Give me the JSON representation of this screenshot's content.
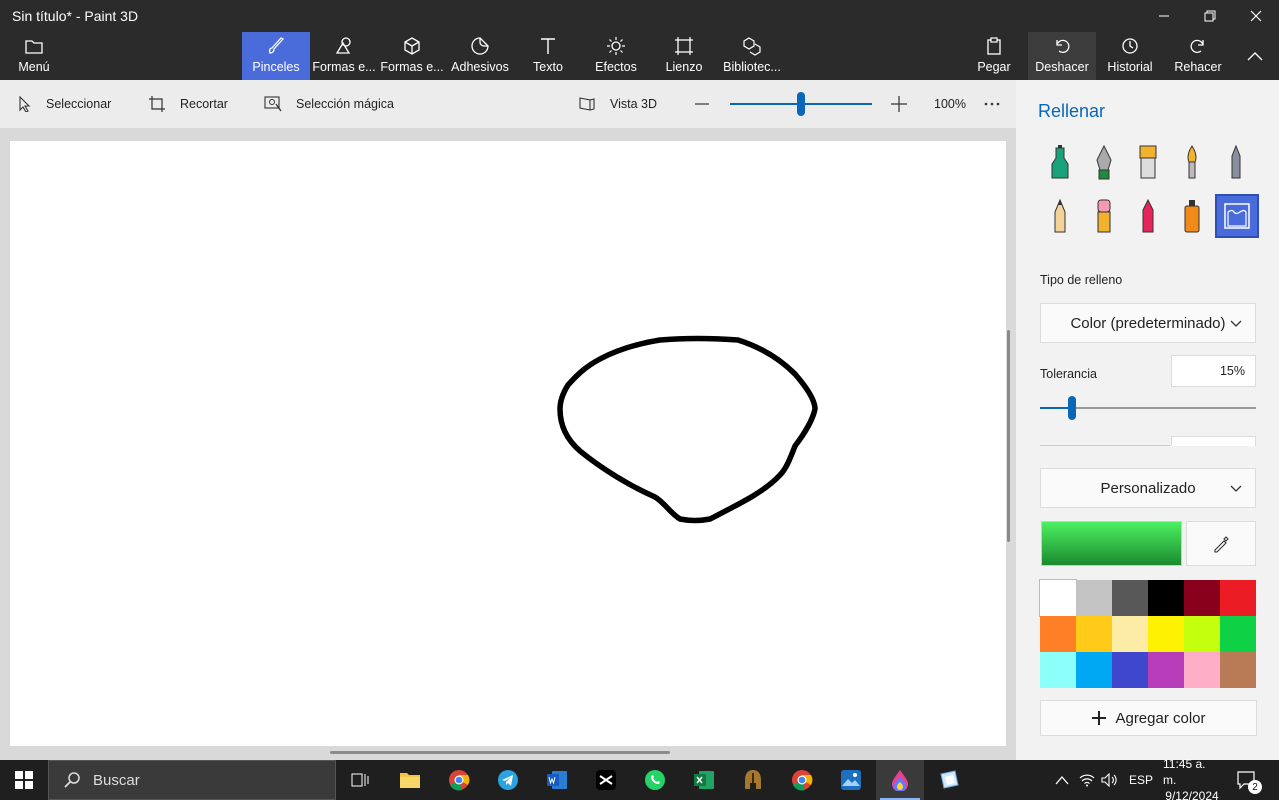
{
  "window": {
    "title": "Sin título* - Paint 3D"
  },
  "toolbar": {
    "menu": "Menú",
    "items": [
      {
        "label": "Pinceles"
      },
      {
        "label": "Formas e..."
      },
      {
        "label": "Formas e..."
      },
      {
        "label": "Adhesivos"
      },
      {
        "label": "Texto"
      },
      {
        "label": "Efectos"
      },
      {
        "label": "Lienzo"
      },
      {
        "label": "Bibliotec..."
      }
    ],
    "right": [
      {
        "label": "Pegar"
      },
      {
        "label": "Deshacer"
      },
      {
        "label": "Historial"
      },
      {
        "label": "Rehacer"
      }
    ]
  },
  "subbar": {
    "select": "Seleccionar",
    "crop": "Recortar",
    "magic": "Selección mágica",
    "view3d": "Vista 3D",
    "zoom": "100%",
    "zoom_fraction": 0.5
  },
  "panel": {
    "title": "Rellenar",
    "fill_type_label": "Tipo de relleno",
    "fill_type_value": "Color (predeterminado)",
    "tolerance_label": "Tolerancia",
    "tolerance_value": "15%",
    "tolerance_fraction": 0.15,
    "palette_mode": "Personalizado",
    "add_color": "Agregar color",
    "current_color": "#2fc44a",
    "palette": [
      "#ffffff",
      "#c3c3c3",
      "#585858",
      "#000000",
      "#88001b",
      "#ec1c24",
      "#ff7f27",
      "#ffca18",
      "#fdeca6",
      "#fff200",
      "#c4ff0e",
      "#0ed145",
      "#8cfffb",
      "#00a8f3",
      "#3f48cc",
      "#b83dba",
      "#ffaec8",
      "#b97a56"
    ]
  },
  "taskbar": {
    "search_placeholder": "Buscar",
    "lang": "ESP",
    "time": "11:45 a. m.",
    "date": "9/12/2024",
    "notifications": "2"
  }
}
